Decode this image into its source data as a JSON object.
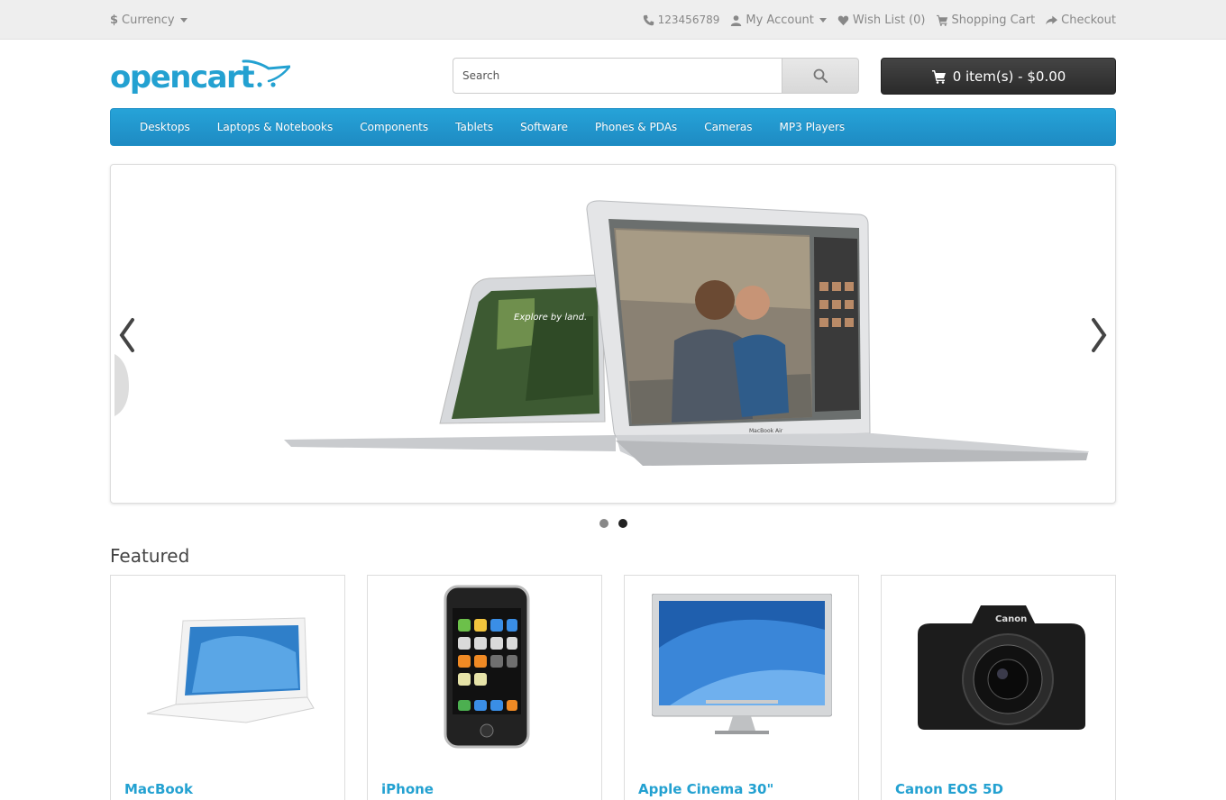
{
  "topbar": {
    "currency_symbol": "$",
    "currency_label": "Currency",
    "phone": "123456789",
    "my_account": "My Account",
    "wishlist": "Wish List (0)",
    "shopping_cart": "Shopping Cart",
    "checkout": "Checkout"
  },
  "header": {
    "logo_text": "opencart",
    "search_placeholder": "Search",
    "cart_summary": "0 item(s) - $0.00"
  },
  "nav": {
    "items": [
      "Desktops",
      "Laptops & Notebooks",
      "Components",
      "Tablets",
      "Software",
      "Phones & PDAs",
      "Cameras",
      "MP3 Players"
    ]
  },
  "slideshow": {
    "slide_caption_left": "Explore by land.",
    "laptop_brand": "MacBook Air",
    "slide_count": 2,
    "active_slide": 2
  },
  "featured": {
    "title": "Featured",
    "products": [
      {
        "name": "MacBook",
        "icon": "macbook-image"
      },
      {
        "name": "iPhone",
        "icon": "iphone-image"
      },
      {
        "name": "Apple Cinema 30\"",
        "icon": "cinema-display-image"
      },
      {
        "name": "Canon EOS 5D",
        "icon": "canon-camera-image"
      }
    ]
  },
  "colors": {
    "accent": "#23a1d1",
    "nav": "#1e8bc3",
    "cart_button": "#363636"
  }
}
